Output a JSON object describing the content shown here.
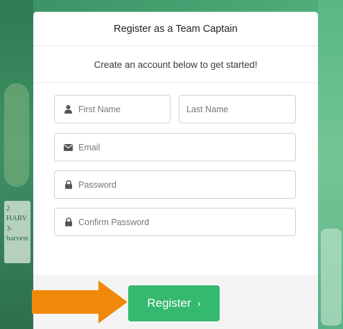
{
  "background": {
    "sign_text": "2\nHARV\n3-harvest"
  },
  "card": {
    "title": "Register as a Team Captain",
    "subtitle": "Create an account below to get started!"
  },
  "form": {
    "first_name": {
      "placeholder": "First Name",
      "icon": "user-icon"
    },
    "last_name": {
      "placeholder": "Last Name"
    },
    "email": {
      "placeholder": "Email",
      "icon": "envelope-icon"
    },
    "password": {
      "placeholder": "Password",
      "icon": "lock-icon"
    },
    "confirm_password": {
      "placeholder": "Confirm Password",
      "icon": "lock-icon"
    }
  },
  "register_button": {
    "label": "Register",
    "chevron": "›"
  },
  "annotation": {
    "arrow_color": "#f0890a"
  },
  "colors": {
    "brand_green": "#35b86f",
    "background_green": "#47a573"
  }
}
